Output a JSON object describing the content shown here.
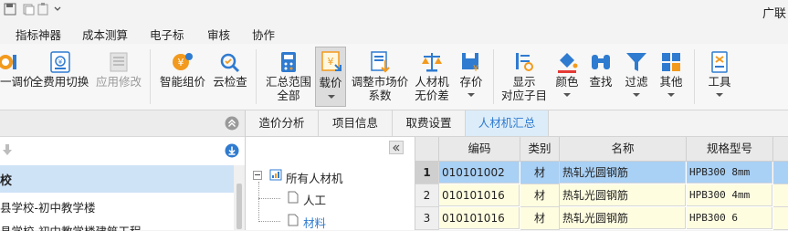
{
  "titlebar": {
    "app_title": "广联"
  },
  "menubar": {
    "tabs": [
      "指标神器",
      "成本测算",
      "电子标",
      "审核",
      "协作"
    ]
  },
  "ribbon": {
    "buttons": [
      {
        "id": "adjust",
        "label": "一调价"
      },
      {
        "id": "fee-switch",
        "label": "全费用切换"
      },
      {
        "id": "app-edit",
        "label": "应用修改"
      },
      {
        "id": "smart-price",
        "label": "智能组价"
      },
      {
        "id": "cloud-check",
        "label": "云检查"
      },
      {
        "id": "summary-range",
        "label_line1": "汇总范围",
        "label_line2": "全部"
      },
      {
        "id": "load-price",
        "label": "载价"
      },
      {
        "id": "adjust-market",
        "label_line1": "调整市场价",
        "label_line2": "系数"
      },
      {
        "id": "no-price-diff",
        "label_line1": "人材机",
        "label_line2": "无价差"
      },
      {
        "id": "store-price",
        "label": "存价"
      },
      {
        "id": "show-sub",
        "label_line1": "显示",
        "label_line2": "对应子目"
      },
      {
        "id": "color",
        "label": "颜色"
      },
      {
        "id": "find",
        "label": "查找"
      },
      {
        "id": "filter",
        "label": "过滤"
      },
      {
        "id": "other",
        "label": "其他"
      },
      {
        "id": "tools",
        "label": "工具"
      }
    ]
  },
  "leftpane": {
    "selected_item": "校",
    "item2": "县学校-初中教学楼",
    "item3": "县学校-初中教学楼建筑工程"
  },
  "content_tabs": [
    "造价分析",
    "项目信息",
    "取费设置",
    "人材机汇总"
  ],
  "active_tab": "人材机汇总",
  "tree": {
    "root": "所有人材机",
    "children": [
      "人工",
      "材料"
    ]
  },
  "grid": {
    "columns": [
      "编码",
      "类别",
      "名称",
      "规格型号"
    ],
    "rows": [
      {
        "num": "1",
        "code": "010101002",
        "type": "材",
        "name": "热轧光圆钢筋",
        "spec": "HPB300 8mm"
      },
      {
        "num": "2",
        "code": "010101016",
        "type": "材",
        "name": "热轧光圆钢筋",
        "spec": "HPB300 4mm"
      },
      {
        "num": "3",
        "code": "010101016",
        "type": "材",
        "name": "热轧光圆钢筋",
        "spec": "HPB300 6"
      }
    ]
  },
  "colors": {
    "active_tab_bg": "#dcecf9",
    "selected_row_bg": "#a9d0f5",
    "row_yellow": "#fffde0",
    "accent_blue": "#2f7bd0",
    "accent_orange": "#f29a1e"
  }
}
